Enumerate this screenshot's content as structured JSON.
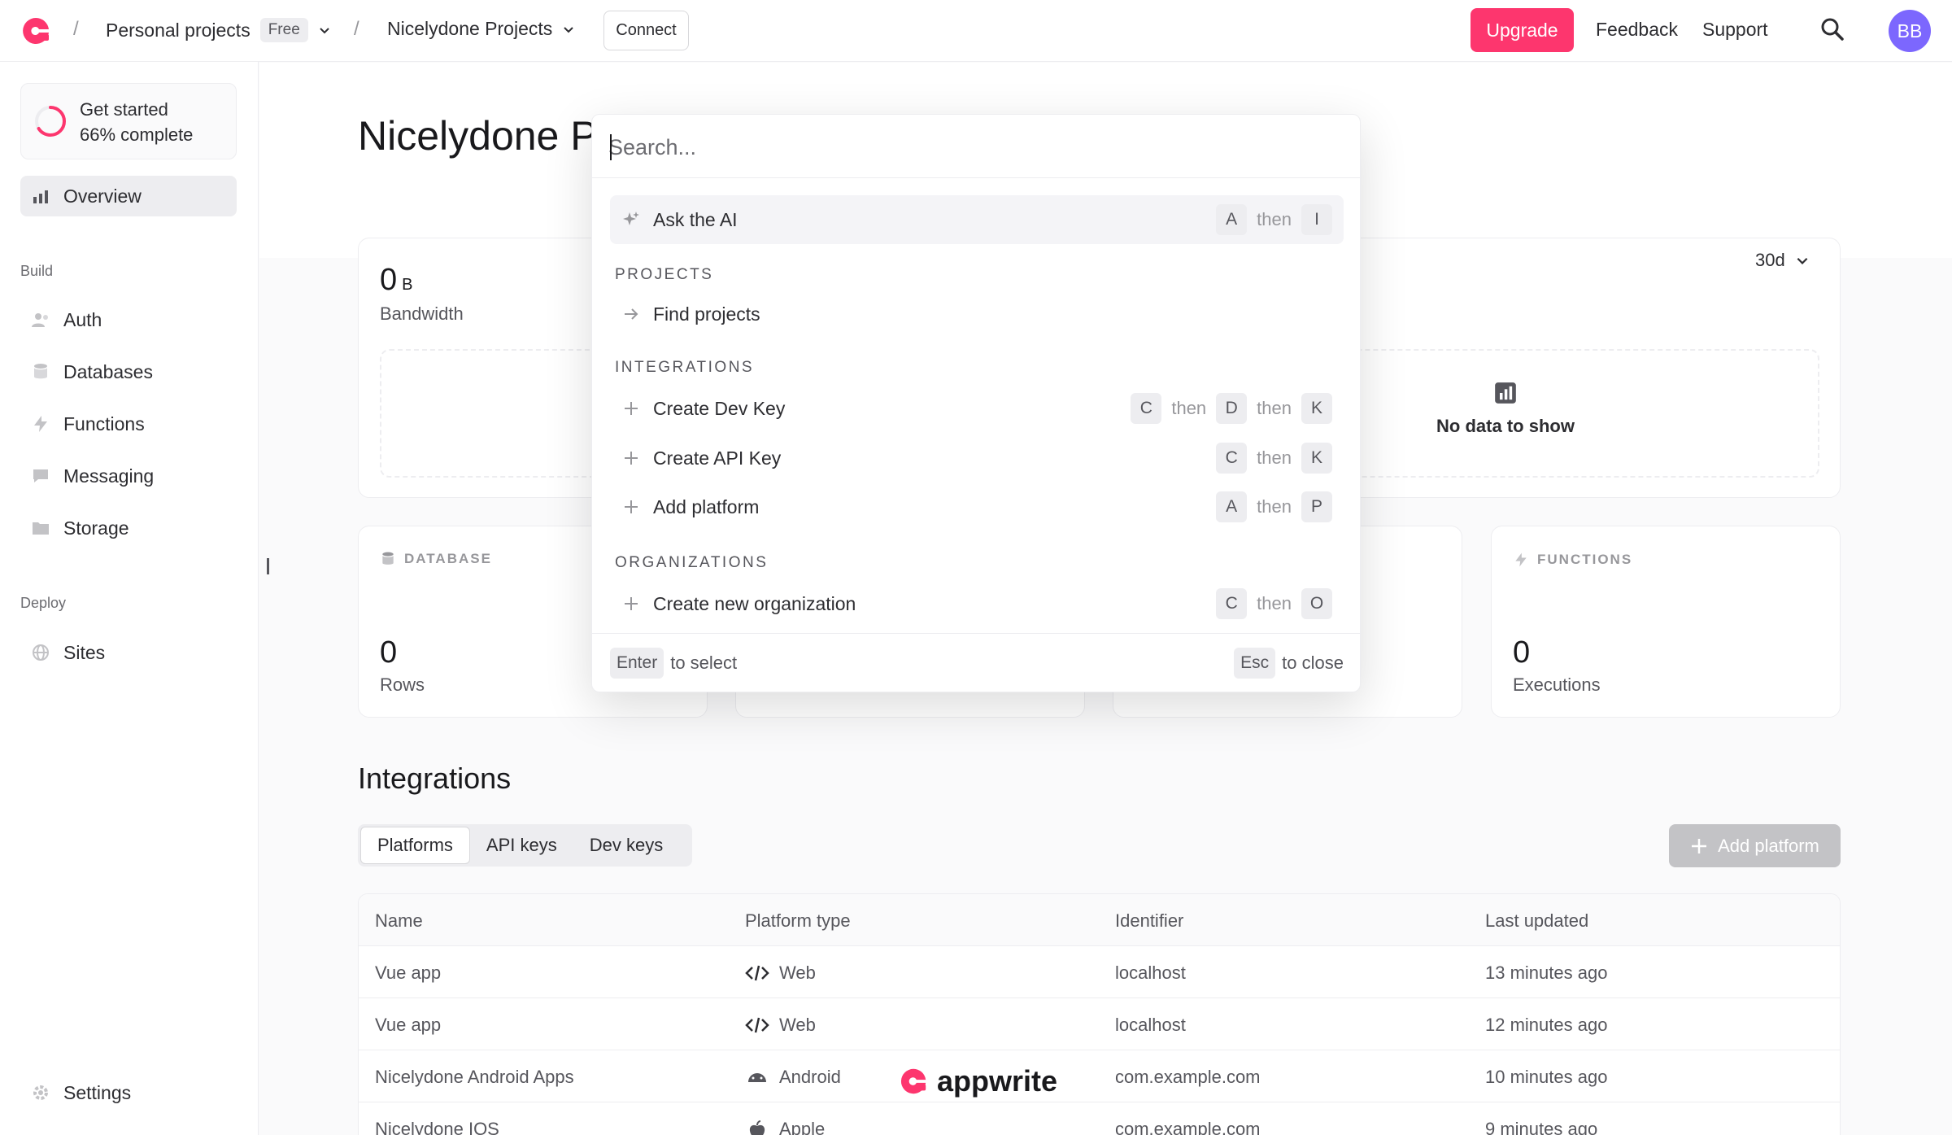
{
  "topbar": {
    "project_group": "Personal projects",
    "plan_badge": "Free",
    "project": "Nicelydone Projects",
    "connect_label": "Connect",
    "upgrade_label": "Upgrade",
    "feedback_label": "Feedback",
    "support_label": "Support",
    "avatar_initials": "BB",
    "separator": "/"
  },
  "sidebar": {
    "get_started_title": "Get started",
    "get_started_progress": "66% complete",
    "progress_percent": 66,
    "overview": "Overview",
    "section_build": "Build",
    "build_items": [
      "Auth",
      "Databases",
      "Functions",
      "Messaging",
      "Storage"
    ],
    "section_deploy": "Deploy",
    "deploy_items": [
      "Sites"
    ],
    "settings": "Settings"
  },
  "main": {
    "title": "Nicelydone P",
    "bandwidth_value": "0",
    "bandwidth_unit": "B",
    "bandwidth_label": "Bandwidth",
    "range": "30d",
    "no_data": "No data to show",
    "database_head": "DATABASE",
    "database_value": "0",
    "database_label": "Rows",
    "functions_head": "FUNCTIONS",
    "functions_value": "0",
    "functions_label": "Executions",
    "integrations_title": "Integrations",
    "tabs": [
      "Platforms",
      "API keys",
      "Dev keys"
    ],
    "add_platform": "Add platform",
    "table": {
      "headers": [
        "Name",
        "Platform type",
        "Identifier",
        "Last updated"
      ],
      "rows": [
        [
          "Vue app",
          "Web",
          "localhost",
          "13 minutes ago"
        ],
        [
          "Vue app",
          "Web",
          "localhost",
          "12 minutes ago"
        ],
        [
          "Nicelydone Android Apps",
          "Android",
          "com.example.com",
          "10 minutes ago"
        ],
        [
          "Nicelydone IOS",
          "Apple",
          "com.example.com",
          "9 minutes ago"
        ]
      ]
    },
    "watermark": "appwrite"
  },
  "palette": {
    "search_placeholder": "Search...",
    "ask_ai": "Ask the AI",
    "then": "then",
    "group_projects": "PROJECTS",
    "find_projects": "Find projects",
    "group_integrations": "INTEGRATIONS",
    "create_dev_key": "Create Dev Key",
    "create_api_key": "Create API Key",
    "add_platform": "Add platform",
    "group_organizations": "ORGANIZATIONS",
    "create_org": "Create new organization",
    "keys": {
      "ai": [
        "A",
        "I"
      ],
      "dev": [
        "C",
        "D",
        "K"
      ],
      "api": [
        "C",
        "K"
      ],
      "platform": [
        "A",
        "P"
      ],
      "org": [
        "C",
        "O"
      ]
    },
    "footer_enter": "Enter",
    "footer_select": "to select",
    "footer_esc": "Esc",
    "footer_close": "to close"
  },
  "colors": {
    "accent": "#fd366e",
    "avatar": "#7c67fe"
  }
}
